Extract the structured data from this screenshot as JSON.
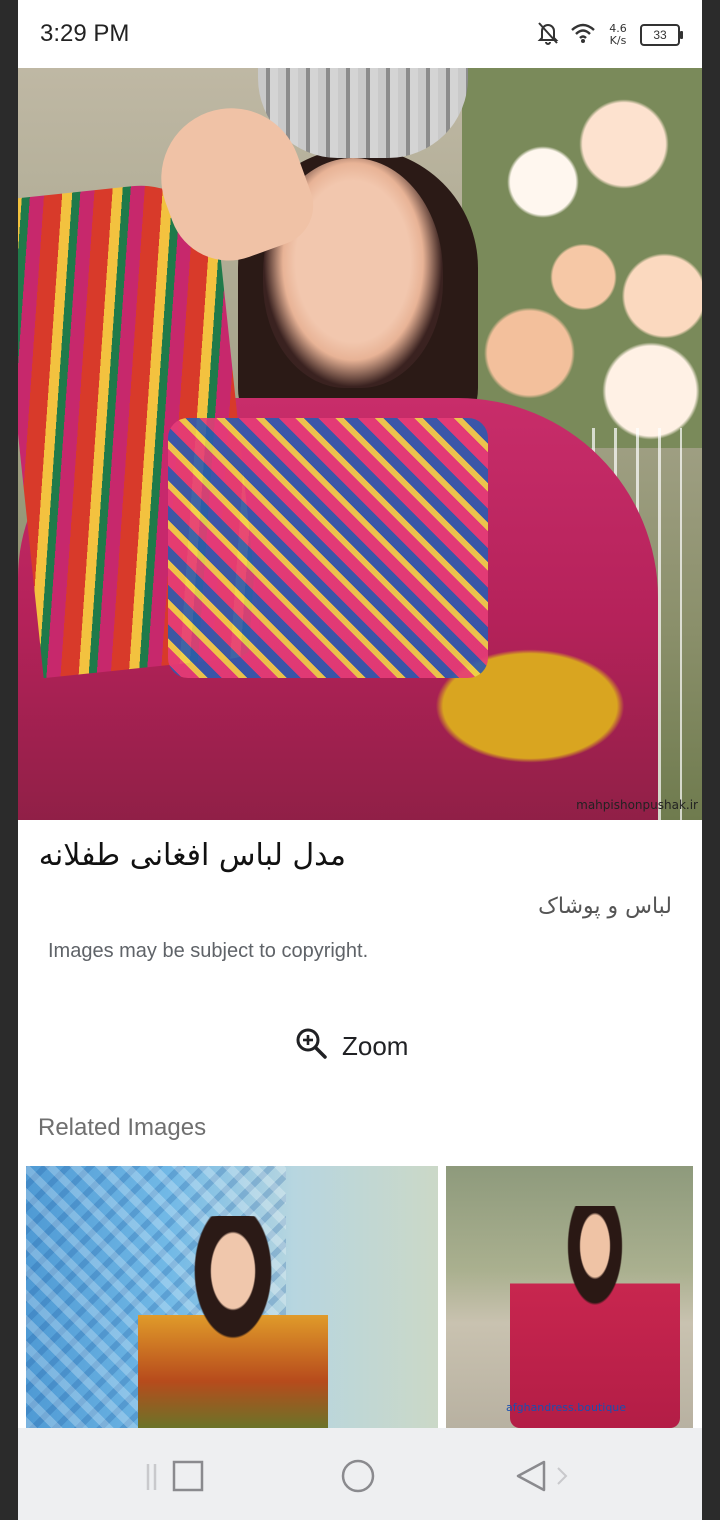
{
  "status_bar": {
    "time": "3:29 PM",
    "net_speed_value": "4.6",
    "net_speed_unit": "K/s",
    "battery": "33"
  },
  "image": {
    "watermark": "mahpishonpushak.ir"
  },
  "details": {
    "title": "مدل لباس افغانی طفلانه",
    "category": "لباس و پوشاک",
    "copyright": "Images may be subject to copyright.",
    "zoom_label": "Zoom"
  },
  "related": {
    "heading": "Related Images",
    "items": [
      {
        "watermark": ""
      },
      {
        "watermark": "afghandress.boutique"
      }
    ]
  },
  "icons": {
    "status": [
      "bell-off-icon",
      "wifi-icon",
      "battery-icon"
    ],
    "zoom": "zoom-in-icon",
    "nav": [
      "recent-apps-icon",
      "home-icon",
      "back-icon"
    ]
  }
}
